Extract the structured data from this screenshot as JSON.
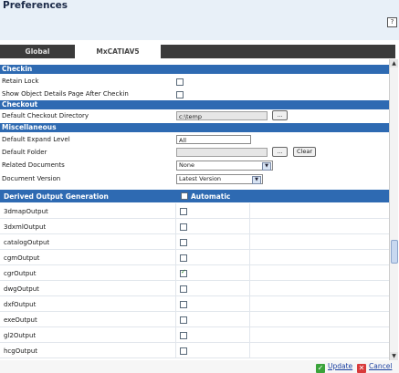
{
  "window": {
    "title": "Preferences",
    "help": "?"
  },
  "tabs": [
    {
      "label": "Global"
    },
    {
      "label": "MxCATIAV5"
    }
  ],
  "sections": {
    "checkin": "Checkin",
    "checkout": "Checkout",
    "misc": "Miscellaneous"
  },
  "checkin": {
    "retain_lock": "Retain Lock",
    "show_object_details": "Show Object Details Page After Checkin"
  },
  "checkout": {
    "default_dir_label": "Default Checkout Directory",
    "default_dir_value": "c:\\temp",
    "browse": "..."
  },
  "misc": {
    "expand_label": "Default Expand Level",
    "expand_value": "All",
    "folder_label": "Default Folder",
    "folder_value": "",
    "browse": "...",
    "clear": "Clear",
    "related_label": "Related Documents",
    "related_value": "None",
    "version_label": "Document Version",
    "version_value": "Latest Version"
  },
  "derived": {
    "header": "Derived Output Generation",
    "automatic": "Automatic",
    "rows": [
      {
        "name": "3dmapOutput",
        "checked": false
      },
      {
        "name": "3dxmlOutput",
        "checked": false
      },
      {
        "name": "catalogOutput",
        "checked": false
      },
      {
        "name": "cgmOutput",
        "checked": false
      },
      {
        "name": "cgrOutput",
        "checked": true
      },
      {
        "name": "dwgOutput",
        "checked": false
      },
      {
        "name": "dxfOutput",
        "checked": false
      },
      {
        "name": "exeOutput",
        "checked": false
      },
      {
        "name": "gl2Output",
        "checked": false
      },
      {
        "name": "hcgOutput",
        "checked": false
      }
    ]
  },
  "footer": {
    "update": "Update",
    "cancel": "Cancel"
  }
}
